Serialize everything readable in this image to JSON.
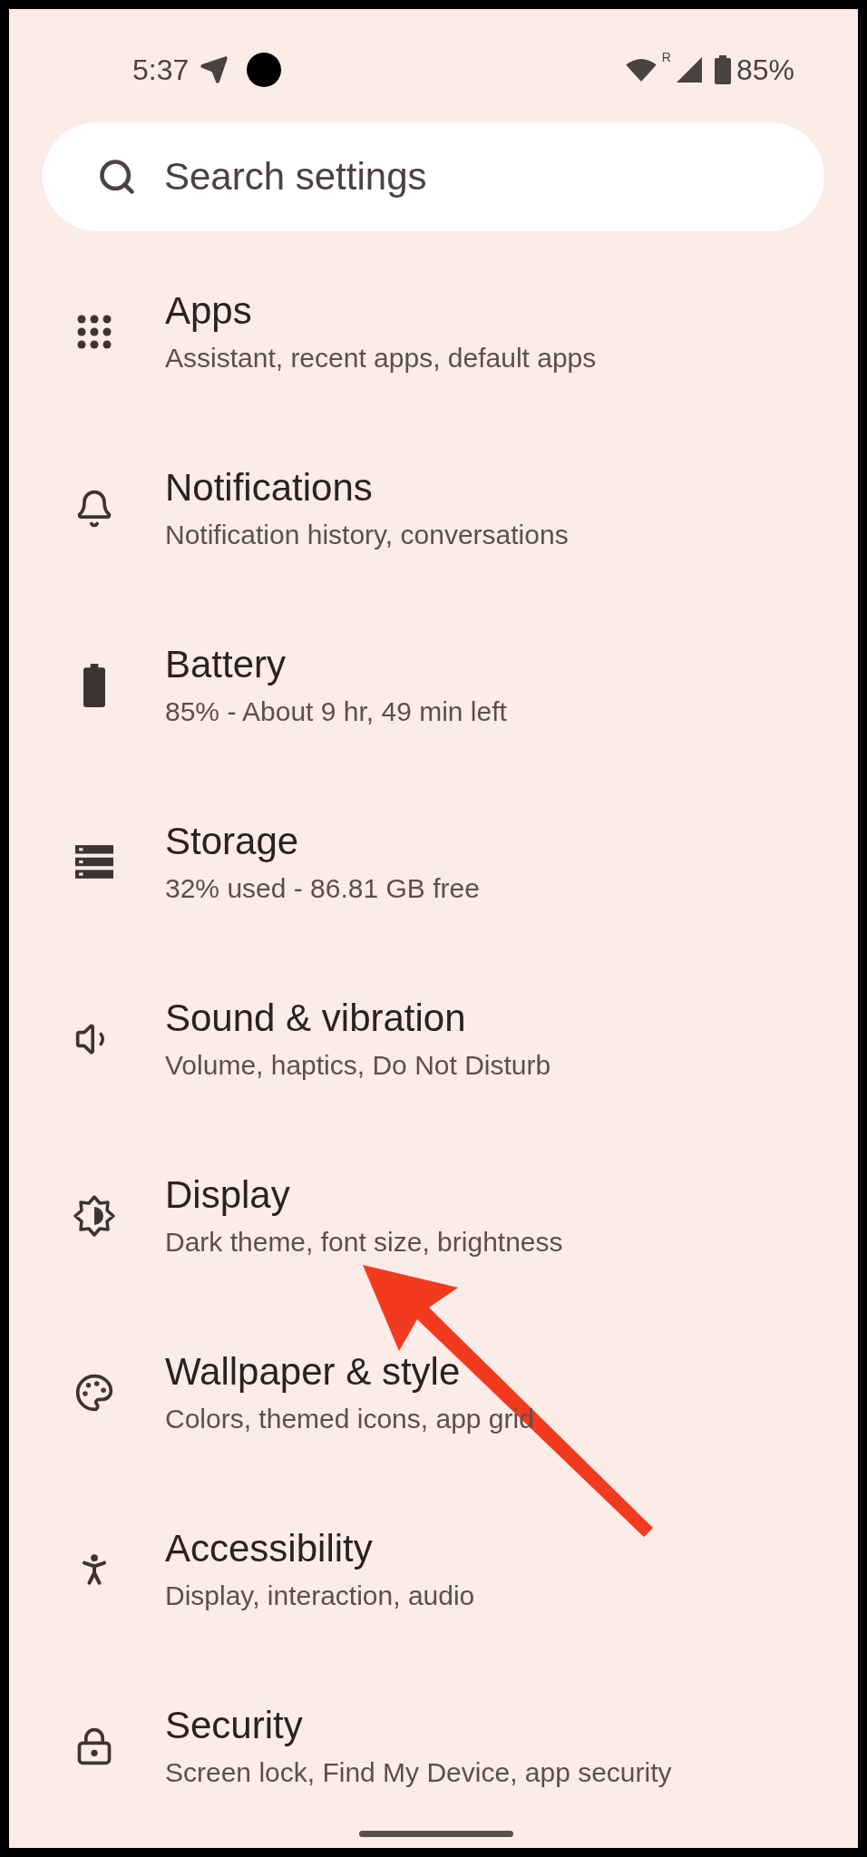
{
  "status_bar": {
    "time": "5:37",
    "roaming": "R",
    "battery": "85%"
  },
  "search": {
    "placeholder": "Search settings"
  },
  "items": [
    {
      "title": "Apps",
      "subtitle": "Assistant, recent apps, default apps"
    },
    {
      "title": "Notifications",
      "subtitle": "Notification history, conversations"
    },
    {
      "title": "Battery",
      "subtitle": "85% - About 9 hr, 49 min left"
    },
    {
      "title": "Storage",
      "subtitle": "32% used - 86.81 GB free"
    },
    {
      "title": "Sound & vibration",
      "subtitle": "Volume, haptics, Do Not Disturb"
    },
    {
      "title": "Display",
      "subtitle": "Dark theme, font size, brightness"
    },
    {
      "title": "Wallpaper & style",
      "subtitle": "Colors, themed icons, app grid"
    },
    {
      "title": "Accessibility",
      "subtitle": "Display, interaction, audio"
    },
    {
      "title": "Security",
      "subtitle": "Screen lock, Find My Device, app security"
    }
  ]
}
